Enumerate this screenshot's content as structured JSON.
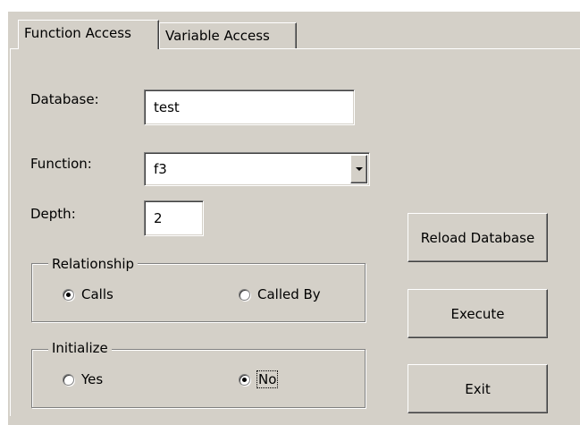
{
  "tabs": [
    {
      "label": "Function Access",
      "active": true
    },
    {
      "label": "Variable Access",
      "active": false
    }
  ],
  "form": {
    "database_label": "Database:",
    "database_value": "test",
    "function_label": "Function:",
    "function_value": "f3",
    "depth_label": "Depth:",
    "depth_value": "2"
  },
  "relationship": {
    "title": "Relationship",
    "options": [
      {
        "label": "Calls",
        "selected": true
      },
      {
        "label": "Called By",
        "selected": false
      }
    ]
  },
  "initialize": {
    "title": "Initialize",
    "options": [
      {
        "label": "Yes",
        "selected": false
      },
      {
        "label": "No",
        "selected": true
      }
    ]
  },
  "buttons": {
    "reload": "Reload Database",
    "execute": "Execute",
    "exit": "Exit"
  },
  "colors": {
    "face": "#d4d0c8",
    "field": "#ffffff"
  }
}
